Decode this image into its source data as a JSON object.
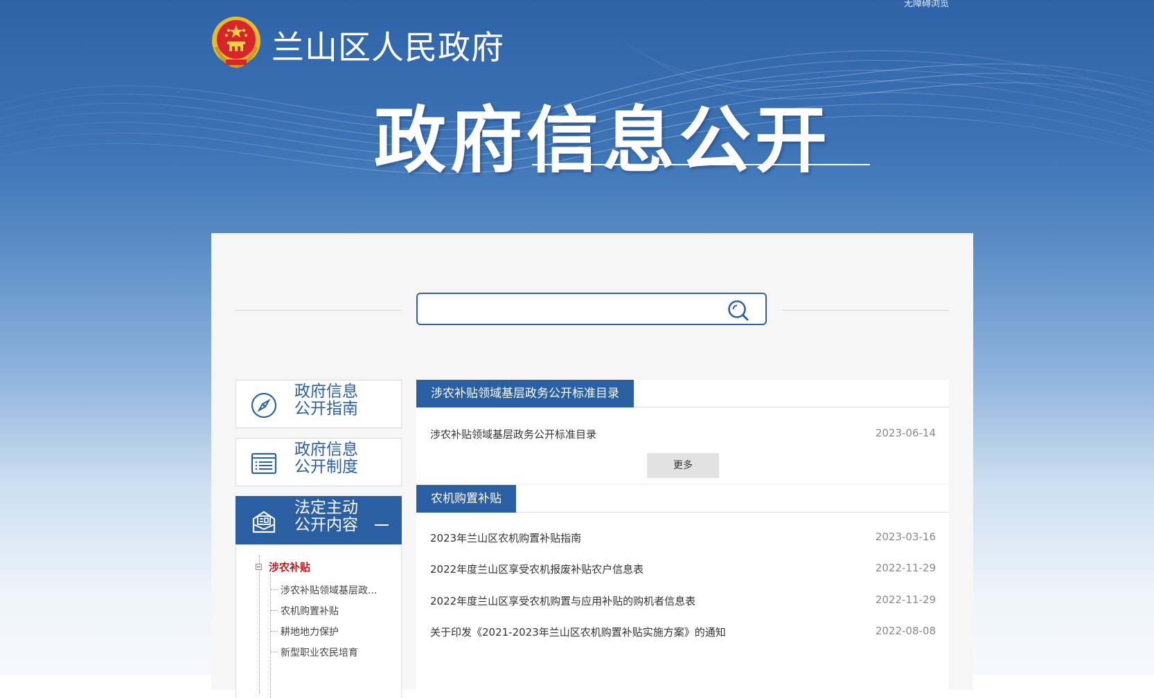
{
  "header": {
    "accessibility_link": "无障碍浏览",
    "site_title": "兰山区人民政府",
    "hero_title": "政府信息公开"
  },
  "search": {
    "value": "",
    "placeholder": ""
  },
  "sidebar": {
    "cards": [
      {
        "label_line1": "政府信息",
        "label_line2": "公开指南",
        "icon": "compass-icon"
      },
      {
        "label_line1": "政府信息",
        "label_line2": "公开制度",
        "icon": "document-list-icon"
      },
      {
        "label_line1": "法定主动",
        "label_line2": "公开内容",
        "icon": "open-content-icon",
        "active": true
      }
    ],
    "tree": {
      "root_label": "涉农补贴",
      "items": [
        "涉农补贴领域基层政...",
        "农机购置补贴",
        "耕地地力保护",
        "新型职业农民培育"
      ]
    }
  },
  "sections": [
    {
      "title": "涉农补贴领域基层政务公开标准目录",
      "more_label": "更多",
      "rows": [
        {
          "title": "涉农补贴领域基层政务公开标准目录",
          "date": "2023-06-14"
        }
      ]
    },
    {
      "title": "农机购置补贴",
      "rows": [
        {
          "title": "2023年兰山区农机购置补贴指南",
          "date": "2023-03-16"
        },
        {
          "title": "2022年度兰山区享受农机报废补贴农户信息表",
          "date": "2022-11-29"
        },
        {
          "title": "2022年度兰山区享受农机购置与应用补贴的购机者信息表",
          "date": "2022-11-29"
        },
        {
          "title": "关于印发《2021-2023年兰山区农机购置补贴实施方案》的通知",
          "date": "2022-08-08"
        }
      ]
    }
  ],
  "colors": {
    "brand_blue": "#2b5fa3",
    "tree_root_red": "#c8161d"
  }
}
